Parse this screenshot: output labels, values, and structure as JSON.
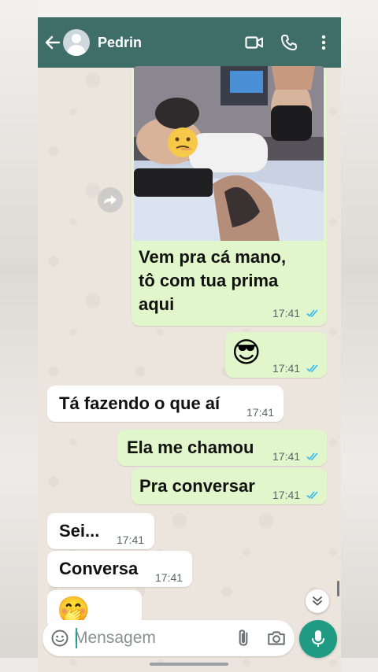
{
  "header": {
    "contact_name": "Pedrin"
  },
  "messages": [
    {
      "direction": "outgoing",
      "type": "image",
      "caption": [
        "Vem pra cá mano,",
        "tô com tua prima",
        "aqui"
      ],
      "time": "17:41",
      "status": "read"
    },
    {
      "direction": "outgoing",
      "type": "emoji",
      "text": "😎",
      "time": "17:41",
      "status": "read"
    },
    {
      "direction": "incoming",
      "text": "Tá fazendo o que aí",
      "time": "17:41"
    },
    {
      "direction": "outgoing",
      "text": "Ela me chamou",
      "time": "17:41",
      "status": "read"
    },
    {
      "direction": "outgoing",
      "text": "Pra conversar",
      "time": "17:41",
      "status": "read"
    },
    {
      "direction": "incoming",
      "text": "Sei...",
      "time": "17:41"
    },
    {
      "direction": "incoming",
      "text": "Conversa",
      "time": "17:41"
    },
    {
      "direction": "incoming",
      "type": "emoji",
      "text": "🤭"
    }
  ],
  "composer": {
    "placeholder": "Mensagem"
  },
  "icons": {
    "back": "arrow-left-icon",
    "video": "video-call-icon",
    "call": "phone-call-icon",
    "menu": "more-vert-icon",
    "emoji": "emoji-icon",
    "attach": "paperclip-icon",
    "camera": "camera-icon",
    "mic": "mic-icon",
    "forward": "forward-icon",
    "scroll_down": "double-chevron-down-icon"
  },
  "colors": {
    "header": "#3f6d67",
    "outgoing_bubble": "#e1f7cb",
    "incoming_bubble": "#ffffff",
    "read_ticks": "#34b7f1",
    "mic_button": "#1f9b84"
  }
}
